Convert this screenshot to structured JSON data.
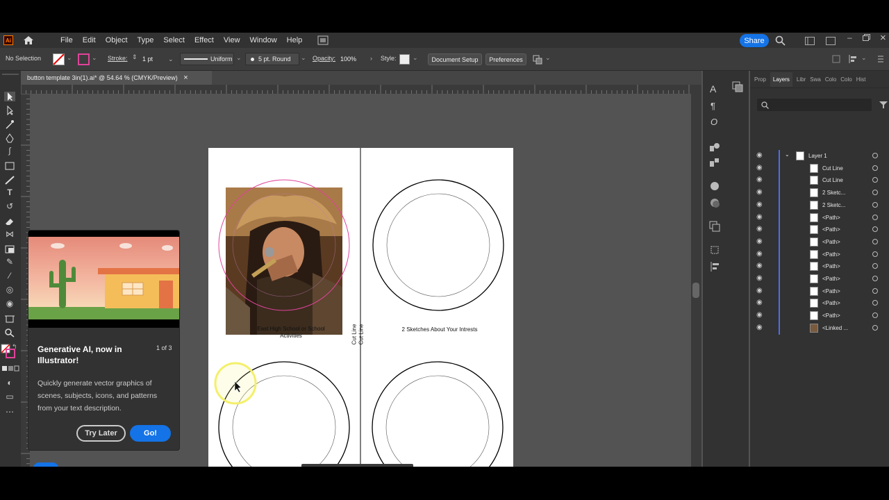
{
  "menubar": {
    "app_logo": "Ai",
    "items": [
      "File",
      "Edit",
      "Object",
      "Type",
      "Select",
      "Effect",
      "View",
      "Window",
      "Help"
    ],
    "share_label": "Share"
  },
  "controlbar": {
    "selection": "No Selection",
    "stroke_label": "Stroke:",
    "stroke_weight": "1 pt",
    "profile": "Uniform",
    "brush": "5 pt. Round",
    "opacity_label": "Opacity:",
    "opacity_value": "100%",
    "style_label": "Style:",
    "document_setup": "Document Setup",
    "preferences": "Preferences"
  },
  "document": {
    "tab_title": "button template 3in(1).ai* @ 54.64 % (CMYK/Preview)",
    "close_glyph": "×"
  },
  "artboard": {
    "caption_left": "East High School or School Activities",
    "caption_right": "2 Sketches About Your Intrests",
    "cut_line_1": "Cut Line",
    "cut_line_2": "Cut Line"
  },
  "popup": {
    "title": "Generative AI, now in Illustrator!",
    "count": "1 of 3",
    "body": "Quickly generate vector graphics of scenes, subjects, icons, and patterns from your text description.",
    "try_later": "Try Later",
    "go": "Go!"
  },
  "panels": {
    "tabs": [
      "Prop",
      "Layers",
      "Libr",
      "Swa",
      "Colo",
      "Colo",
      "Hist"
    ],
    "active_tab": "Layers",
    "layers": [
      {
        "name": "Layer 1",
        "level": 0
      },
      {
        "name": "Cut Line",
        "level": 1
      },
      {
        "name": "Cut Line",
        "level": 1
      },
      {
        "name": "2 Sketc...",
        "level": 1
      },
      {
        "name": "2 Sketc...",
        "level": 1
      },
      {
        "name": "<Path>",
        "level": 1
      },
      {
        "name": "<Path>",
        "level": 1
      },
      {
        "name": "<Path>",
        "level": 1
      },
      {
        "name": "<Path>",
        "level": 1
      },
      {
        "name": "<Path>",
        "level": 1
      },
      {
        "name": "<Path>",
        "level": 1
      },
      {
        "name": "<Path>",
        "level": 1
      },
      {
        "name": "<Path>",
        "level": 1
      },
      {
        "name": "<Path>",
        "level": 1
      },
      {
        "name": "<Linked ...",
        "level": 1
      }
    ]
  },
  "colors": {
    "accent": "#1473e6",
    "selection_pink": "#e0439a",
    "layer_blue": "#4b6ee8",
    "cursor_highlight": "#f3f06a"
  }
}
